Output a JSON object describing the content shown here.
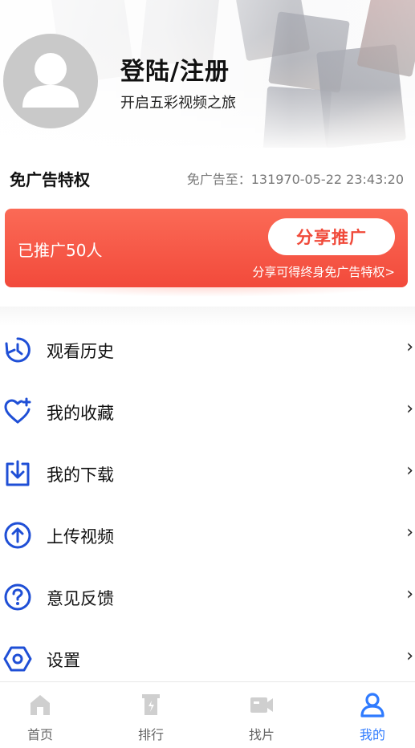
{
  "profile": {
    "title": "登陆/注册",
    "subtitle": "开启五彩视频之旅"
  },
  "privilege": {
    "title": "免广告特权",
    "expiry": "免广告至：131970-05-22 23:43:20"
  },
  "promo": {
    "count_text": "已推广50人",
    "share_button": "分享推广",
    "hint": "分享可得终身免广告特权>"
  },
  "menu": {
    "items": [
      {
        "label": "观看历史",
        "icon": "history-icon"
      },
      {
        "label": "我的收藏",
        "icon": "favorite-heart-icon"
      },
      {
        "label": "我的下载",
        "icon": "download-icon"
      },
      {
        "label": "上传视频",
        "icon": "upload-icon"
      },
      {
        "label": "意见反馈",
        "icon": "feedback-question-icon"
      },
      {
        "label": "设置",
        "icon": "settings-icon"
      }
    ],
    "arrow": "›"
  },
  "tabbar": {
    "items": [
      {
        "label": "首页",
        "icon": "home-icon",
        "active": false
      },
      {
        "label": "排行",
        "icon": "ranking-icon",
        "active": false
      },
      {
        "label": "找片",
        "icon": "video-camera-icon",
        "active": false
      },
      {
        "label": "我的",
        "icon": "user-icon",
        "active": true
      }
    ]
  },
  "colors": {
    "accent_blue": "#2f7bff",
    "icon_blue": "#1f4fd6",
    "promo_red": "#f24a3b",
    "inactive_tab": "#c8c8c8"
  }
}
